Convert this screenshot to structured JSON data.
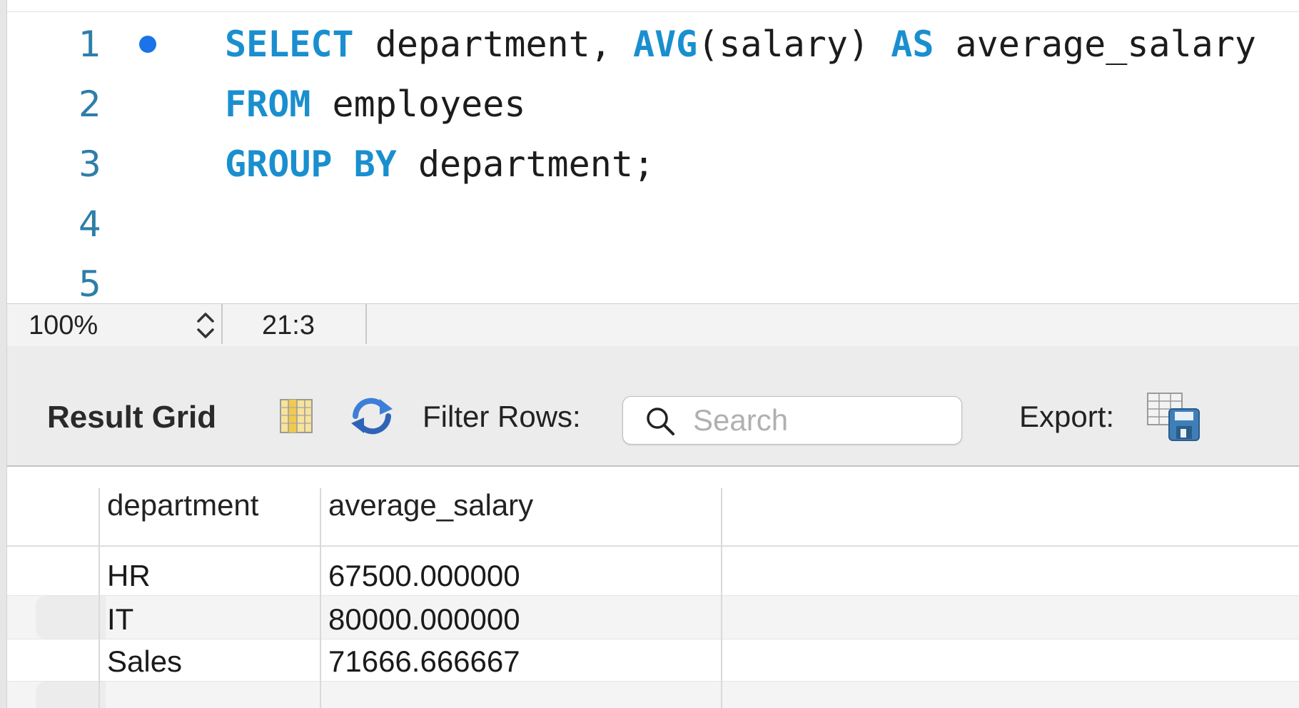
{
  "editor": {
    "lines": [
      {
        "num": "1",
        "has_marker": true,
        "tokens": [
          {
            "t": "SELECT",
            "k": "kw"
          },
          {
            "t": " department, ",
            "k": "txt"
          },
          {
            "t": "AVG",
            "k": "fn"
          },
          {
            "t": "(salary) ",
            "k": "txt"
          },
          {
            "t": "AS",
            "k": "kw"
          },
          {
            "t": " average_salary",
            "k": "txt"
          }
        ]
      },
      {
        "num": "2",
        "has_marker": false,
        "tokens": [
          {
            "t": "FROM",
            "k": "kw"
          },
          {
            "t": " employees",
            "k": "txt"
          }
        ]
      },
      {
        "num": "3",
        "has_marker": false,
        "tokens": [
          {
            "t": "GROUP",
            "k": "kw"
          },
          {
            "t": " ",
            "k": "txt"
          },
          {
            "t": "BY",
            "k": "kw"
          },
          {
            "t": " department;",
            "k": "txt"
          }
        ]
      },
      {
        "num": "4",
        "has_marker": false,
        "tokens": []
      },
      {
        "num": "5",
        "has_marker": false,
        "tokens": []
      }
    ]
  },
  "statusbar": {
    "zoom": "100%",
    "cursor_position": "21:3"
  },
  "toolbar": {
    "title": "Result Grid",
    "filter_label": "Filter Rows:",
    "search_placeholder": "Search",
    "search_value": "",
    "export_label": "Export:"
  },
  "result_grid": {
    "columns": [
      "department",
      "average_salary"
    ],
    "rows": [
      [
        "HR",
        "67500.000000"
      ],
      [
        "IT",
        "80000.000000"
      ],
      [
        "Sales",
        "71666.666667"
      ]
    ]
  },
  "colors": {
    "keyword": "#1a8fcf",
    "line_number": "#2d7ea8",
    "marker": "#1a73e8"
  }
}
